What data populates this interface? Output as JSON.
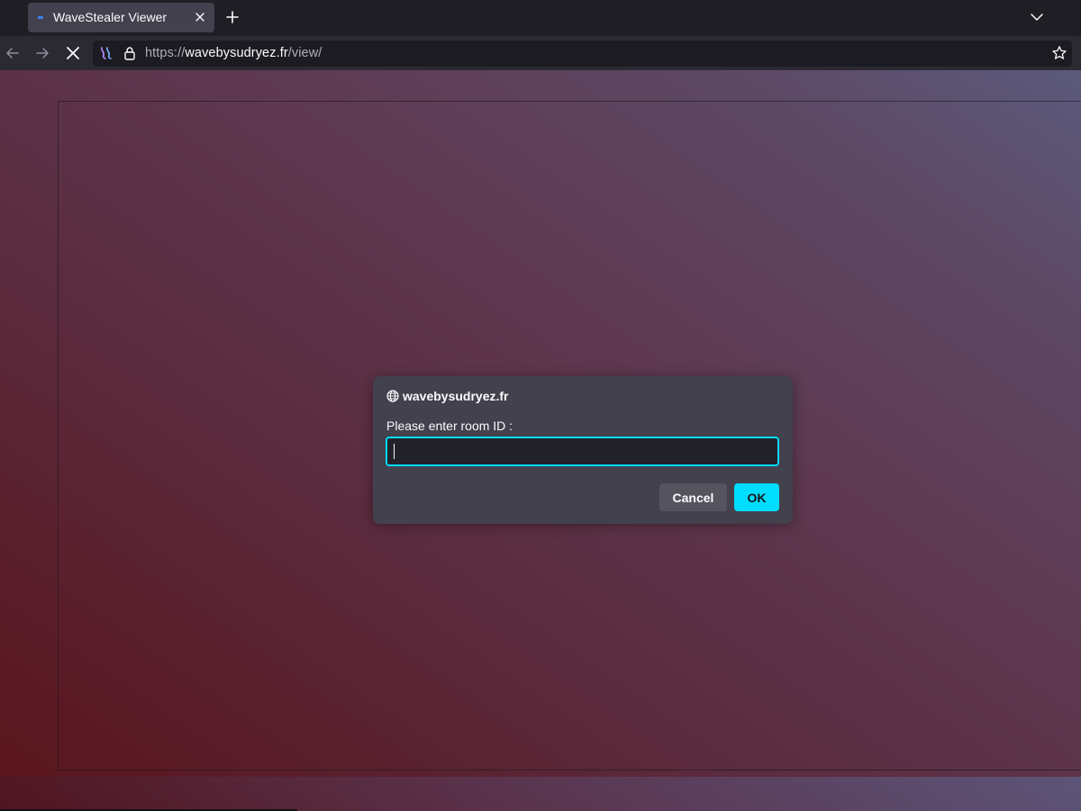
{
  "browser": {
    "tab": {
      "title": "WaveStealer Viewer",
      "favicon_color": "#3b82f6"
    },
    "address_bar": {
      "scheme": "https://",
      "host": "wavebysudryez.fr",
      "path": "/view/"
    },
    "icons": {
      "back": "arrow-left-icon",
      "forward": "arrow-right-icon",
      "stop": "close-icon",
      "extension": "extension-icon",
      "lock": "lock-icon",
      "bookmark": "star-icon",
      "new_tab": "plus-icon",
      "tab_list": "chevron-down-icon"
    }
  },
  "dialog": {
    "origin": "wavebysudryez.fr",
    "message": "Please enter room ID :",
    "input_value": "",
    "cancel_label": "Cancel",
    "ok_label": "OK",
    "accent_color": "#00ddff"
  }
}
